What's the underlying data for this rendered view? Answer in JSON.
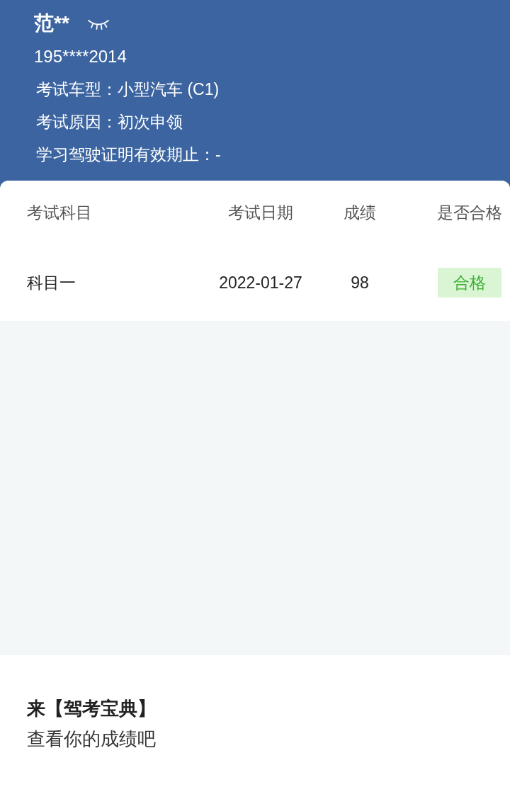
{
  "profile": {
    "name": "范**",
    "masked": true,
    "phone": "195****2014",
    "details": [
      {
        "label": "考试车型：",
        "value": "小型汽车 (C1)"
      },
      {
        "label": "考试原因：",
        "value": "初次申领"
      },
      {
        "label": "学习驾驶证明有效期止：",
        "value": "-"
      }
    ]
  },
  "table": {
    "columns": [
      "考试科目",
      "考试日期",
      "成绩",
      "是否合格"
    ],
    "rows": [
      {
        "subject": "科目一",
        "date": "2022-01-27",
        "score": "98",
        "result": "合格",
        "passed": true
      }
    ]
  },
  "footer": {
    "title": "来【驾考宝典】",
    "subtitle": "查看你的成绩吧"
  }
}
